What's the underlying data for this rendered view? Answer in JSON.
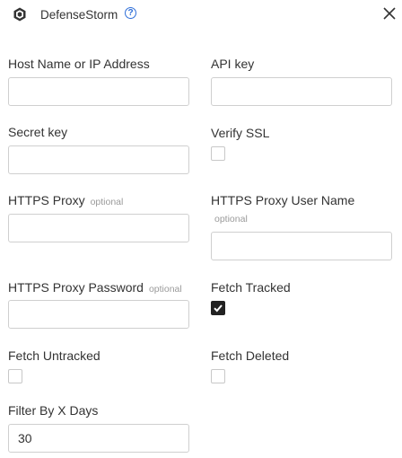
{
  "header": {
    "title": "DefenseStorm",
    "help_icon": "question-circle-icon",
    "close_icon": "close-icon",
    "logo_icon": "defensestorm-logo-icon"
  },
  "fields": {
    "host": {
      "label": "Host Name or IP Address",
      "value": ""
    },
    "api_key": {
      "label": "API key",
      "value": ""
    },
    "secret_key": {
      "label": "Secret key",
      "value": ""
    },
    "verify_ssl": {
      "label": "Verify SSL",
      "checked": false
    },
    "https_proxy": {
      "label": "HTTPS Proxy",
      "optional": "optional",
      "value": ""
    },
    "https_proxy_user": {
      "label": "HTTPS Proxy User Name",
      "optional": "optional",
      "value": ""
    },
    "https_proxy_password": {
      "label": "HTTPS Proxy Password",
      "optional": "optional",
      "value": ""
    },
    "fetch_tracked": {
      "label": "Fetch Tracked",
      "checked": true
    },
    "fetch_untracked": {
      "label": "Fetch Untracked",
      "checked": false
    },
    "fetch_deleted": {
      "label": "Fetch Deleted",
      "checked": false
    },
    "filter_days": {
      "label": "Filter By X Days",
      "value": "30"
    }
  },
  "colors": {
    "accent": "#2f6fd8",
    "checkbox_checked": "#222222",
    "border": "#cfcfcf"
  }
}
